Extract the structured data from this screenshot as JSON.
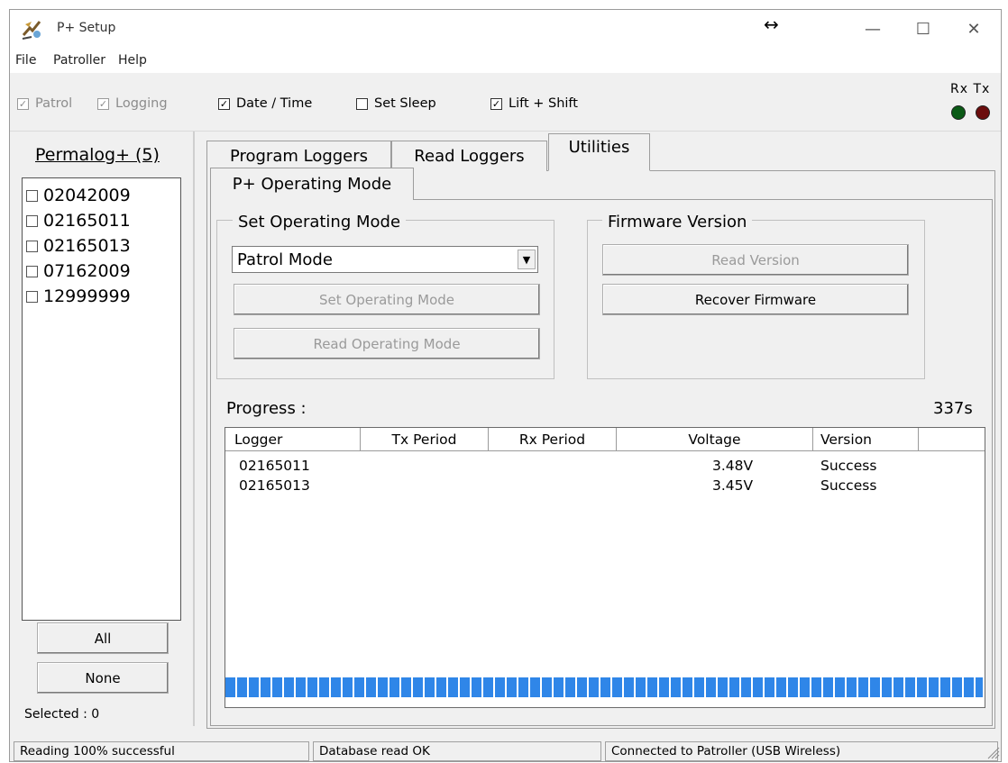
{
  "window": {
    "title": "P+ Setup"
  },
  "menu": [
    "File",
    "Patroller",
    "Help"
  ],
  "options": {
    "patrol": "Patrol",
    "logging": "Logging",
    "date_time": "Date / Time",
    "set_sleep": "Set Sleep",
    "lift_shift": "Lift + Shift",
    "rx_tx": "Rx Tx",
    "rx_color": "#0b5a16",
    "tx_color": "#6b0d0d"
  },
  "left_panel": {
    "title": "Permalog+ (5)",
    "loggers": [
      "02042009",
      "02165011",
      "02165013",
      "07162009",
      "12999999"
    ],
    "all_button": "All",
    "none_button": "None",
    "selected": "Selected : 0"
  },
  "tabs": [
    "Program Loggers",
    "Read Loggers",
    "Utilities"
  ],
  "subtab": "P+ Operating Mode",
  "operating_mode": {
    "group_label": "Set Operating Mode",
    "selected": "Patrol Mode",
    "set_button": "Set Operating Mode",
    "read_button": "Read Operating Mode"
  },
  "firmware": {
    "group_label": "Firmware Version",
    "read_button": "Read Version",
    "recover_button": "Recover Firmware"
  },
  "progress": {
    "label": "Progress :",
    "timer": "337s",
    "percent": 100
  },
  "results": {
    "columns": [
      "Logger",
      "Tx Period",
      "Rx Period",
      "Voltage",
      "Version"
    ],
    "rows": [
      {
        "logger": "02165011",
        "tx": "",
        "rx": "",
        "voltage": "3.48V",
        "version": "Success"
      },
      {
        "logger": "02165013",
        "tx": "",
        "rx": "",
        "voltage": "3.45V",
        "version": "Success"
      }
    ]
  },
  "status": {
    "left": "Reading 100% successful",
    "middle": "Database read OK",
    "right": "Connected to Patroller (USB Wireless)"
  }
}
